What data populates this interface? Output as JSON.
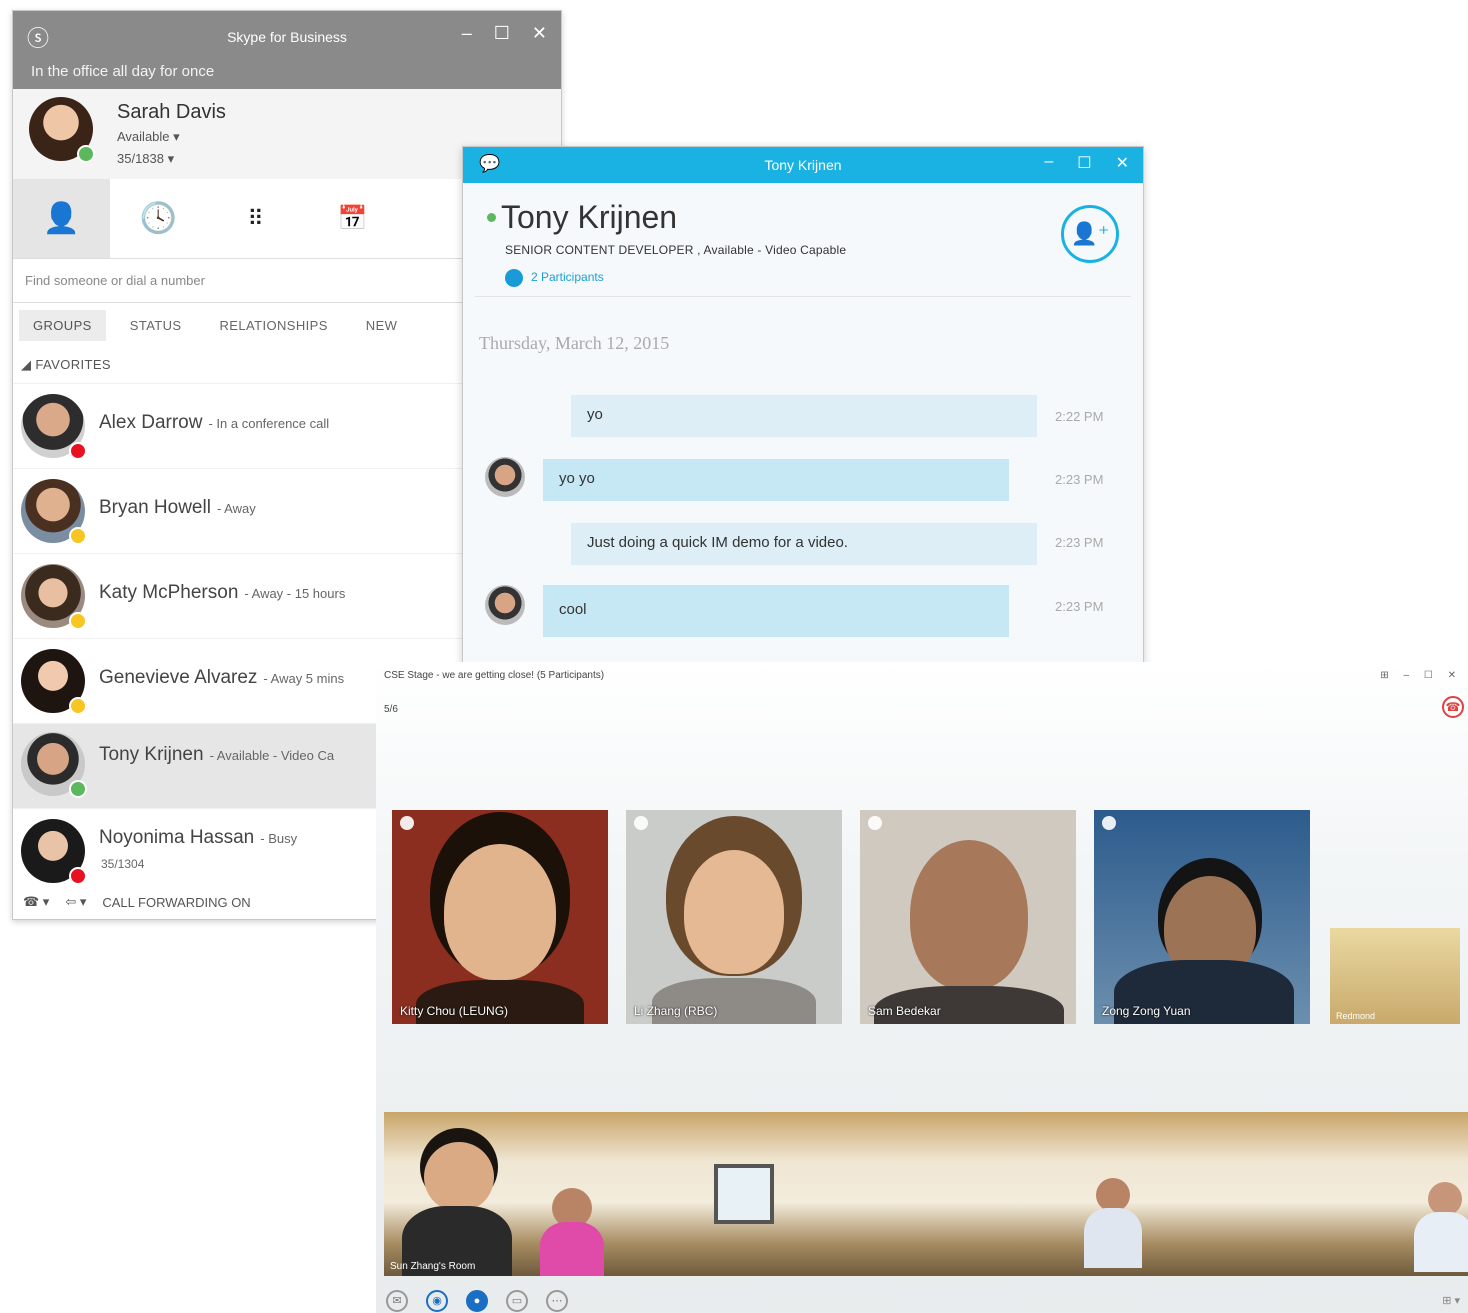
{
  "main_window": {
    "title": "Skype for Business",
    "note": "In the office all day for once",
    "controls": [
      "–",
      "☐",
      "✕"
    ],
    "user": {
      "name": "Sarah Davis",
      "status": "Available ▾",
      "location": "35/1838 ▾"
    },
    "search_placeholder": "Find someone or dial a number",
    "tabs": [
      "GROUPS",
      "STATUS",
      "RELATIONSHIPS",
      "NEW"
    ],
    "group": "◢ FAVORITES",
    "contacts": [
      {
        "name": "Alex Darrow",
        "status": "- In a conference call",
        "sub": ""
      },
      {
        "name": "Bryan Howell",
        "status": "- Away",
        "sub": ""
      },
      {
        "name": "Katy McPherson",
        "status": "- Away - 15 hours",
        "sub": ""
      },
      {
        "name": "Genevieve Alvarez",
        "status": "- Away 5 mins",
        "sub": ""
      },
      {
        "name": "Tony Krijnen",
        "status": "- Available - Video Ca",
        "sub": ""
      },
      {
        "name": "Noyonima Hassan",
        "status": "- Busy",
        "sub": "35/1304"
      }
    ],
    "bottom": {
      "phone": "☎ ▾",
      "forward": "⇦ ▾",
      "forwarding_text": "CALL FORWARDING ON"
    },
    "colors": {
      "titlebar": "#8a8a8a",
      "available": "#5cb85c",
      "busy": "#e81123",
      "away": "#f7c623"
    }
  },
  "chat_window": {
    "title": "Tony Krijnen",
    "controls": [
      "–",
      "☐",
      "✕"
    ],
    "contact_name": "Tony Krijnen",
    "subtitle": "SENIOR CONTENT DEVELOPER , Available - Video Capable",
    "participants": "2 Participants",
    "date": "Thursday, March 12, 2015",
    "messages": [
      {
        "text": "yo",
        "time": "2:22 PM",
        "from": "me"
      },
      {
        "text": "yo yo",
        "time": "2:23 PM",
        "from": "them"
      },
      {
        "text": "Just doing a quick IM demo for a video.",
        "time": "2:23 PM",
        "from": "me"
      },
      {
        "text": "cool",
        "time": "2:23 PM",
        "from": "them"
      }
    ],
    "colors": {
      "titlebar": "#1ab2e3"
    }
  },
  "meeting_window": {
    "title": "CSE Stage - we are getting close! (5 Participants)",
    "count": "5/6",
    "window_controls": "⊞ – ☐ ✕",
    "tiles": [
      {
        "label": "Kitty Chou (LEUNG)"
      },
      {
        "label": "Li Zhang (RBC)"
      },
      {
        "label": "Sam Bedekar"
      },
      {
        "label": "Zong Zong Yuan"
      },
      {
        "label": "Redmond"
      }
    ],
    "panorama_label": "Sun Zhang's Room",
    "bottom_right": "⊞ ▾"
  }
}
